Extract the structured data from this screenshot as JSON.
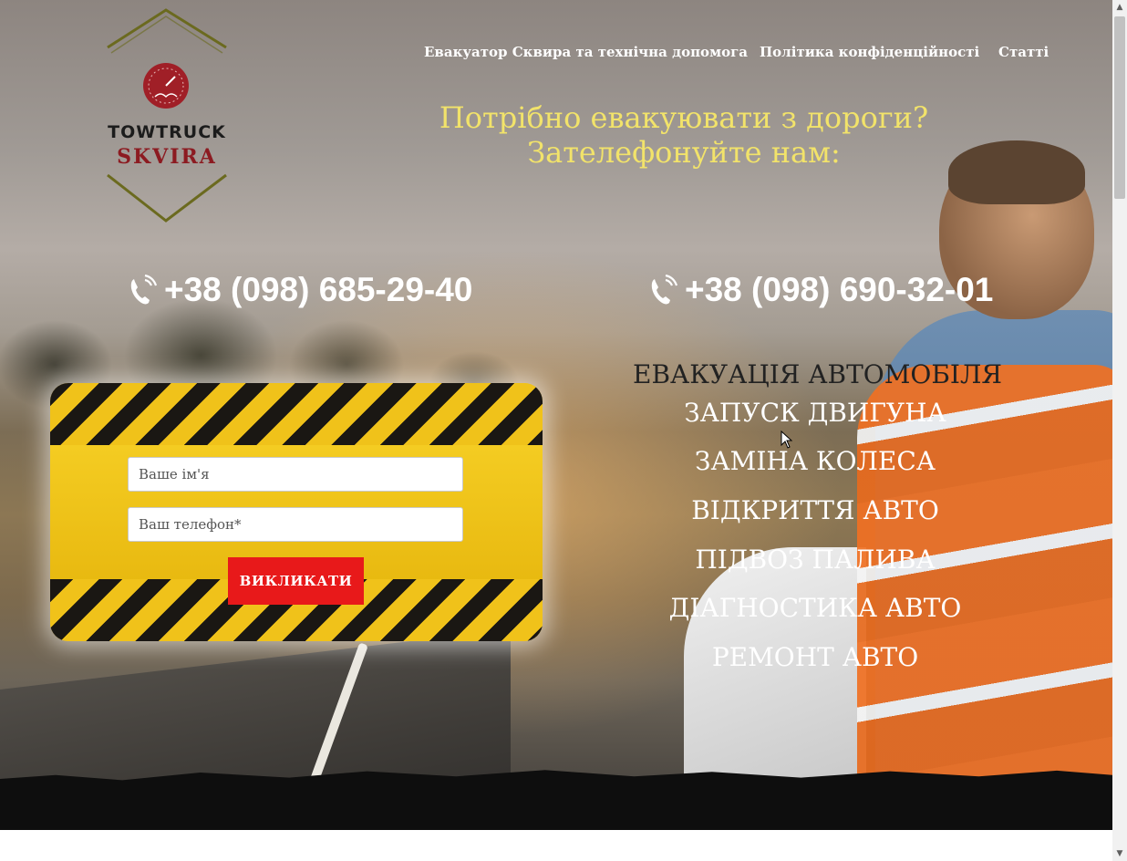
{
  "logo": {
    "line1": "TOWTRUCK",
    "line2": "SKVIRA",
    "colors": {
      "frame": "#6b6a1f",
      "gauge": "#a01f27",
      "line2": "#8c1b21"
    }
  },
  "nav": {
    "items": [
      {
        "label": "Евакуатор Сквира та технічна допомога"
      },
      {
        "label": "Політика конфіденційності"
      },
      {
        "label": "Статті"
      }
    ]
  },
  "headline": {
    "line1": "Потрібно евакуювати з дороги?",
    "line2": "Зателефонуйте нам:",
    "color": "#f2e36a"
  },
  "phones": [
    {
      "number": "+38 (098) 685-29-40",
      "icon": "phone-ringing-icon"
    },
    {
      "number": "+38 (098) 690-32-01",
      "icon": "phone-ringing-icon"
    }
  ],
  "form": {
    "name_placeholder": "Ваше ім'я",
    "name_value": "",
    "phone_placeholder": "Ваш телефон*",
    "phone_value": "",
    "submit_label": "ВИКЛИКАТИ",
    "colors": {
      "panel": "#f0c21a",
      "stripe": "#1a1713",
      "button": "#e8191a"
    }
  },
  "services": [
    "ЕВАКУАЦІЯ АВТОМОБІЛЯ",
    "ЗАПУСК ДВИГУНА",
    "ЗАМІНА КОЛЕСА",
    "ВІДКРИТТЯ АВТО",
    "ПІДВОЗ ПАЛИВА",
    "ДІАГНОСТИКА АВТО",
    "РЕМОНТ АВТО"
  ],
  "scrollbar": {
    "up_icon": "arrow-up-icon",
    "down_icon": "arrow-down-icon"
  }
}
